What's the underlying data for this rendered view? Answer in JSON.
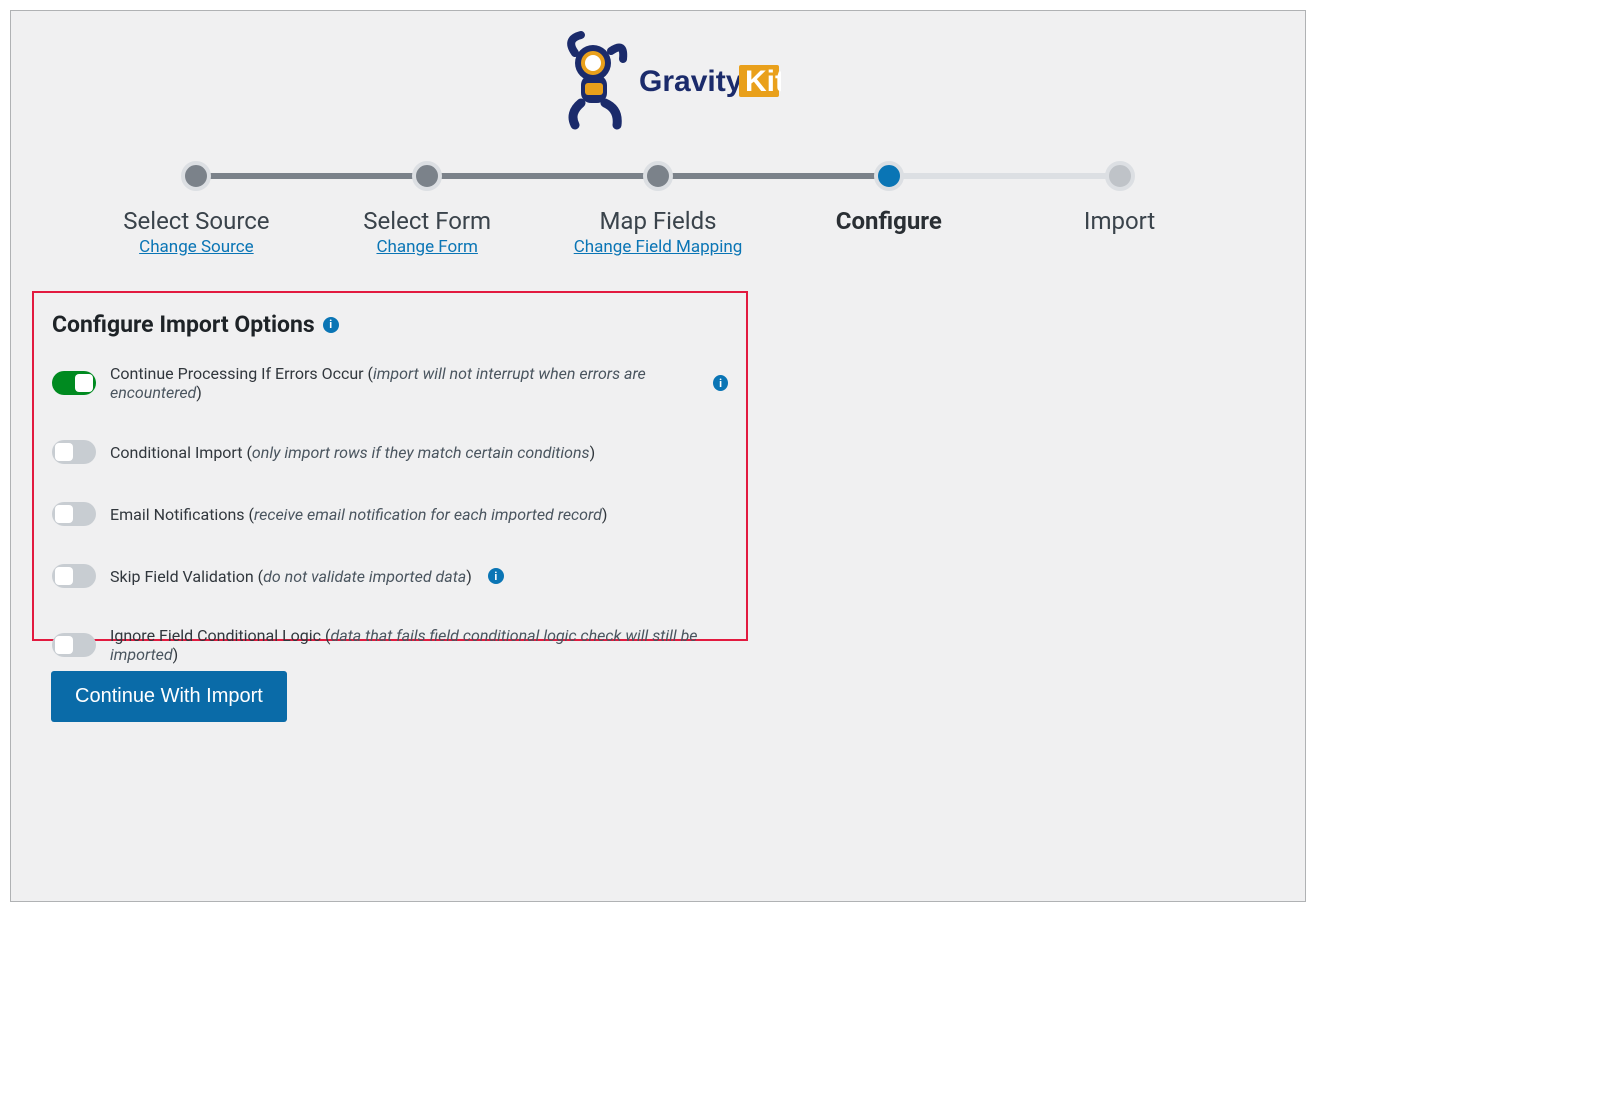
{
  "brand": {
    "name_a": "Gravity",
    "name_b": "Kit"
  },
  "stepper": [
    {
      "label": "Select Source",
      "link": "Change Source",
      "state": "done"
    },
    {
      "label": "Select Form",
      "link": "Change Form",
      "state": "done"
    },
    {
      "label": "Map Fields",
      "link": "Change Field Mapping",
      "state": "done"
    },
    {
      "label": "Configure",
      "link": "",
      "state": "active"
    },
    {
      "label": "Import",
      "link": "",
      "state": "future"
    }
  ],
  "panel": {
    "title": "Configure Import Options",
    "options": [
      {
        "on": true,
        "label": "Continue Processing If Errors Occur",
        "note": "import will not interrupt when errors are encountered",
        "info": true
      },
      {
        "on": false,
        "label": "Conditional Import",
        "note": "only import rows if they match certain conditions",
        "info": false
      },
      {
        "on": false,
        "label": "Email Notifications",
        "note": "receive email notification for each imported record",
        "info": false
      },
      {
        "on": false,
        "label": "Skip Field Validation",
        "note": "do not validate imported data",
        "info": true
      },
      {
        "on": false,
        "label": "Ignore Field Conditional Logic",
        "note": "data that fails field conditional logic check will still be imported",
        "info": false
      }
    ]
  },
  "continue_label": "Continue With Import",
  "colors": {
    "accent": "#0a75b5",
    "brand_orange": "#e9a01b",
    "brand_navy": "#1b2b6b"
  }
}
